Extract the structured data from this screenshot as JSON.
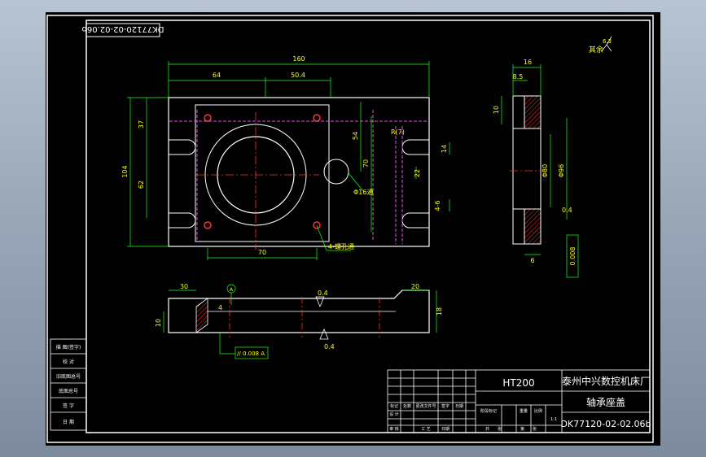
{
  "drawing": {
    "code_tag": "DK77120-02-02.06b",
    "material": "HT200",
    "company": "泰州中兴数控机床厂",
    "part_name": "轴承座盖",
    "drawing_number": "DK77120-02-02.06b",
    "scale": "1:1",
    "roughness_other": "其余",
    "roughness_other_value": "6.3",
    "left_column_labels": [
      "描 图(签字)",
      "校 对",
      "旧底图总号",
      "底图总号",
      "签 字",
      "日 期"
    ],
    "title_block_labels": [
      "标记",
      "处数",
      "更改文件号",
      "签字",
      "日期",
      "设 计",
      "审 核",
      "工 艺",
      "阶段标记",
      "重量",
      "比例",
      "共",
      "张",
      "第",
      "张",
      "日期"
    ]
  },
  "dimensions": {
    "width_total": "160",
    "left_offset": "64",
    "hole_spacing_x": "50.4",
    "height_total": "104",
    "top_offset": "37",
    "hole_spacing_y": "62",
    "bore_bottom": "70",
    "ref_54": "54",
    "ref_70": "70",
    "ref_14": "14",
    "ref_22": "22",
    "ref_4_6": "4-6",
    "slot_r": "R(7)",
    "hole_callout": "4-螺孔通",
    "hole_dia": "Φ16通",
    "side_top_16": "16",
    "side_top_8_5": "8.5",
    "side_10": "10",
    "side_phi_80": "Φ80",
    "side_phi_96": "Φ96",
    "side_bottom_6": "6",
    "side_roughness": "0.4",
    "side_ref_block": "0.008",
    "front_left_30": "30",
    "front_right_20": "20",
    "front_height_10": "10",
    "front_height_18": "18",
    "front_small_4": "4",
    "front_roughness_top": "0.4",
    "front_roughness_bottom": "0.4",
    "datum": "A",
    "parallel_tol": "// 0.008 A"
  }
}
